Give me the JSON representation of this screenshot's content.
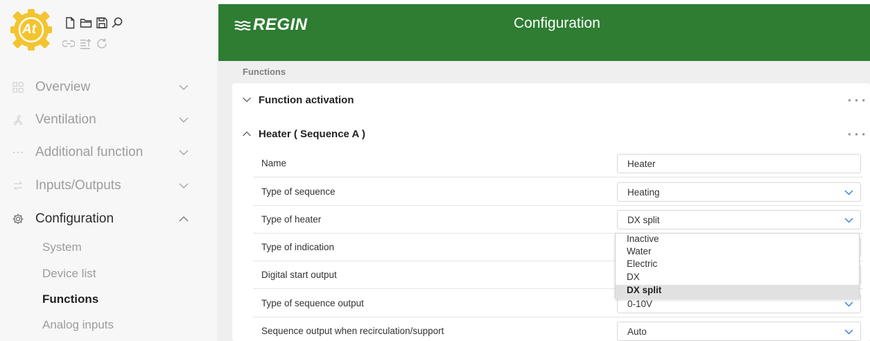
{
  "app": {
    "logo_text": "At"
  },
  "toolbar": {
    "icons": [
      "new-file-icon",
      "open-folder-icon",
      "save-icon",
      "search-icon",
      "link-icon",
      "list-upload-icon",
      "refresh-icon"
    ]
  },
  "sidebar": {
    "items": [
      {
        "label": "Overview",
        "icon": "grid-icon",
        "expanded": false
      },
      {
        "label": "Ventilation",
        "icon": "fan-icon",
        "expanded": false
      },
      {
        "label": "Additional function",
        "icon": "dots-icon",
        "expanded": false
      },
      {
        "label": "Inputs/Outputs",
        "icon": "io-arrows-icon",
        "expanded": false
      },
      {
        "label": "Configuration",
        "icon": "gear-icon",
        "expanded": true
      }
    ],
    "subitems": [
      {
        "label": "System",
        "active": false
      },
      {
        "label": "Device list",
        "active": false
      },
      {
        "label": "Functions",
        "active": true
      },
      {
        "label": "Analog inputs",
        "active": false
      }
    ]
  },
  "header": {
    "brand": "REGIN",
    "title": "Configuration",
    "brand_color": "#2e7d32"
  },
  "main": {
    "breadcrumb": "Functions",
    "sections": [
      {
        "title": "Function activation",
        "expanded": false
      },
      {
        "title": "Heater ( Sequence A )",
        "expanded": true
      }
    ],
    "rows": [
      {
        "label": "Name",
        "value": "Heater",
        "type": "text"
      },
      {
        "label": "Type of sequence",
        "value": "Heating",
        "type": "select"
      },
      {
        "label": "Type of heater",
        "value": "DX split",
        "type": "select"
      },
      {
        "label": "Type of indication",
        "value": "",
        "type": "select"
      },
      {
        "label": "Digital start output",
        "value": "",
        "type": "select"
      },
      {
        "label": "Type of sequence output",
        "value": "0-10V",
        "type": "select"
      },
      {
        "label": "Sequence output when recirculation/support",
        "value": "Auto",
        "type": "select"
      }
    ],
    "dropdown": {
      "options": [
        "Inactive",
        "Water",
        "Electric",
        "DX",
        "DX split"
      ],
      "selected": "DX split"
    }
  },
  "colors": {
    "accent": "#3b7ddd",
    "logo_yellow": "#f4c430"
  }
}
